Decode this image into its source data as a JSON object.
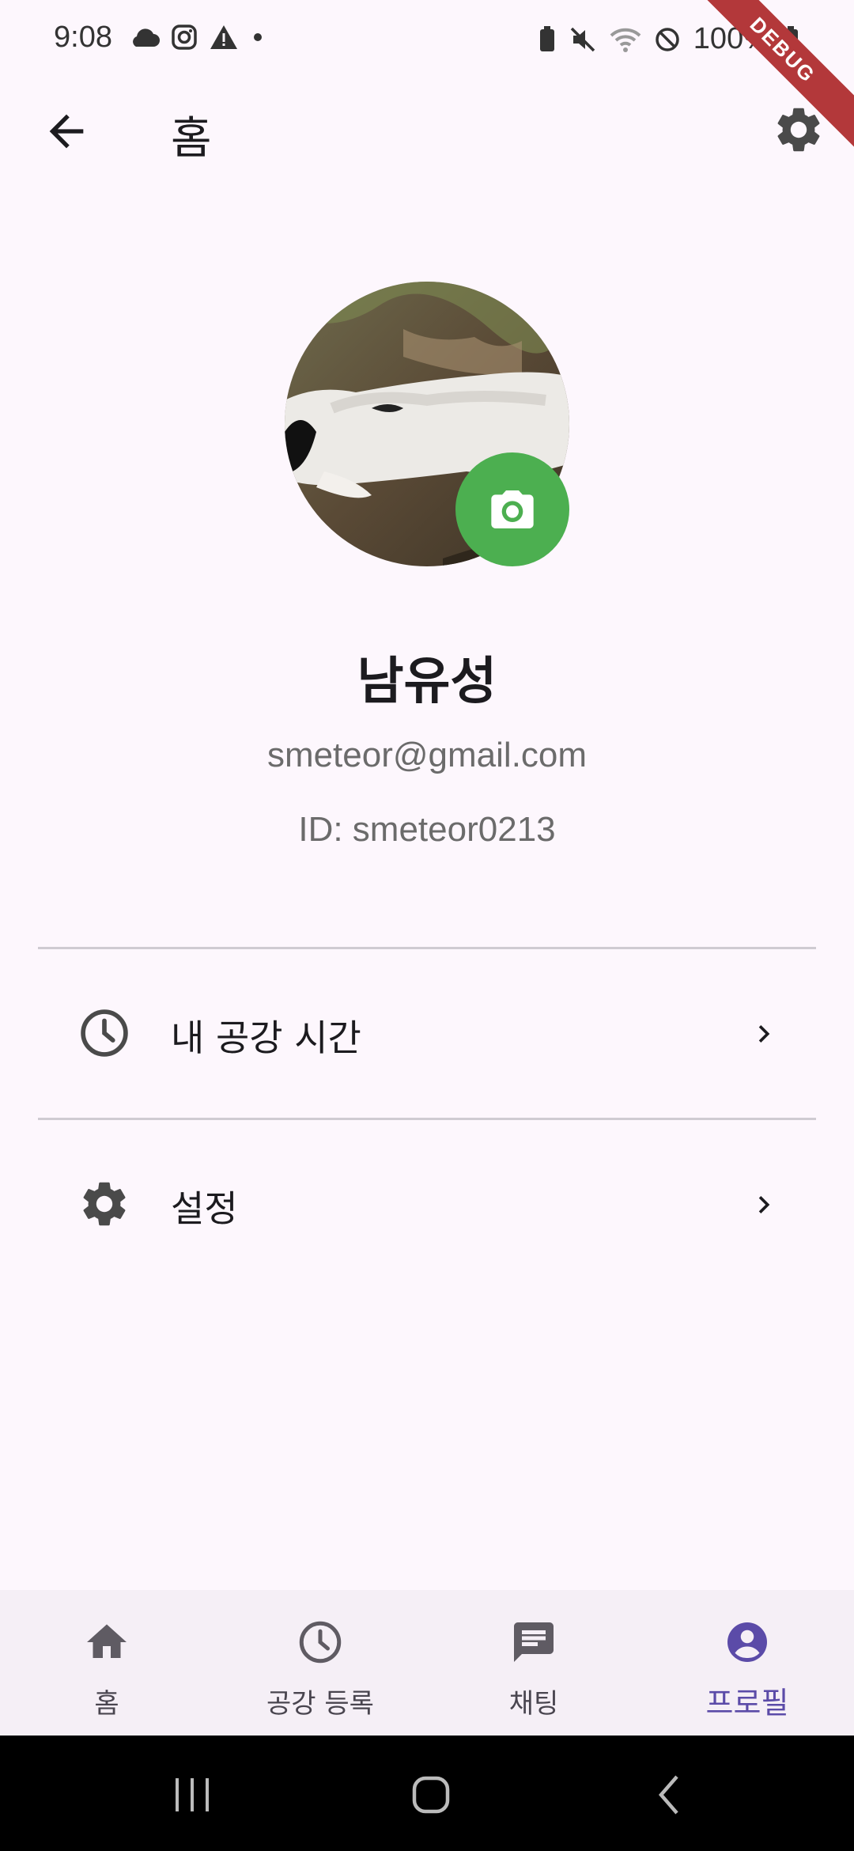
{
  "status_bar": {
    "time": "9:08",
    "battery": "100%",
    "debug_label": "DEBUG"
  },
  "app_bar": {
    "title": "홈"
  },
  "profile": {
    "name": "남유성",
    "email": "smeteor@gmail.com",
    "id": "ID: smeteor0213"
  },
  "menu": [
    {
      "label": "내 공강 시간",
      "icon": "clock-icon"
    },
    {
      "label": "설정",
      "icon": "gear-icon"
    }
  ],
  "bottom_nav": [
    {
      "label": "홈",
      "icon": "home-icon",
      "active": false
    },
    {
      "label": "공강 등록",
      "icon": "clock-icon",
      "active": false
    },
    {
      "label": "채팅",
      "icon": "chat-icon",
      "active": false
    },
    {
      "label": "프로필",
      "icon": "profile-icon",
      "active": true
    }
  ],
  "colors": {
    "background": "#fdf7fd",
    "camera_button": "#4caf50",
    "active_nav": "#5b4ba8"
  }
}
